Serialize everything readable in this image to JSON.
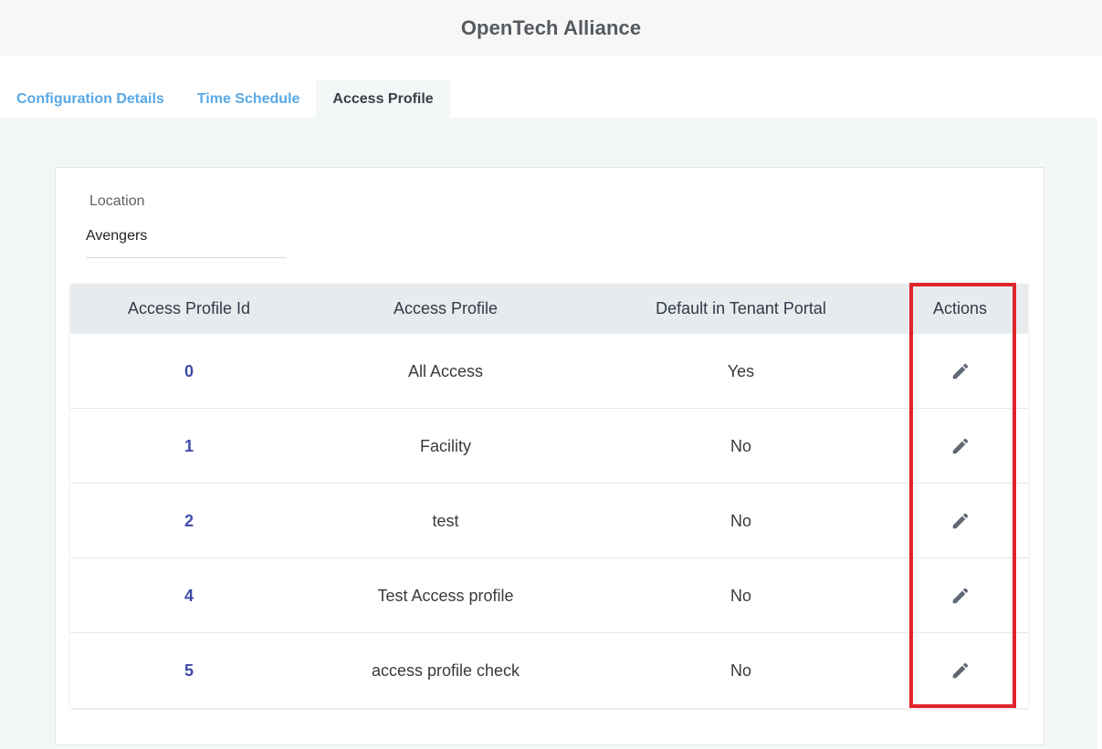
{
  "header": {
    "title": "OpenTech Alliance"
  },
  "tabs": [
    {
      "label": "Configuration Details",
      "active": false
    },
    {
      "label": "Time Schedule",
      "active": false
    },
    {
      "label": "Access Profile",
      "active": true
    }
  ],
  "location": {
    "label": "Location",
    "value": "Avengers"
  },
  "table": {
    "columns": [
      "Access Profile Id",
      "Access Profile",
      "Default in Tenant Portal",
      "Actions"
    ],
    "rows": [
      {
        "id": "0",
        "profile": "All Access",
        "default": "Yes"
      },
      {
        "id": "1",
        "profile": "Facility",
        "default": "No"
      },
      {
        "id": "2",
        "profile": "test",
        "default": "No"
      },
      {
        "id": "4",
        "profile": "Test Access profile",
        "default": "No"
      },
      {
        "id": "5",
        "profile": "access profile check",
        "default": "No"
      }
    ],
    "action_icon": "pencil-icon"
  },
  "colors": {
    "accent_tab": "#5aa9e6",
    "id_link": "#3f4aa8",
    "highlight": "#e0242b"
  }
}
